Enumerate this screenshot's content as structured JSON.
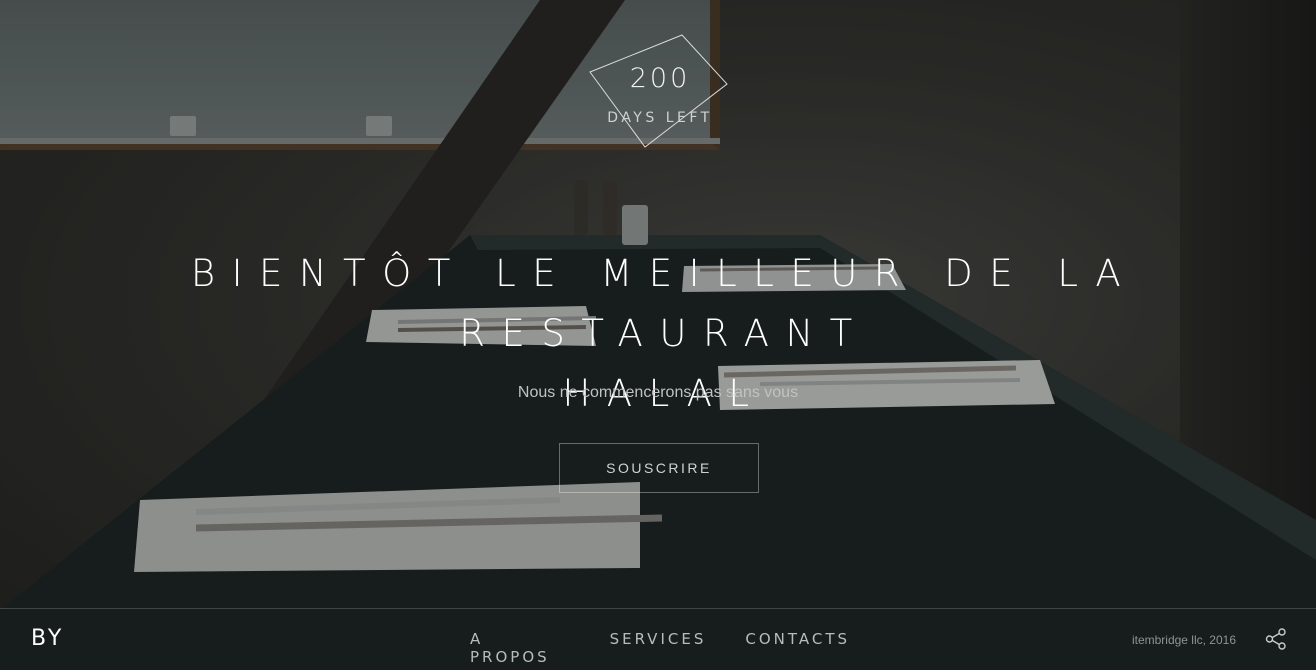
{
  "countdown": {
    "number": "200",
    "label": "DAYS LEFT"
  },
  "hero": {
    "title_line1": "BIENTÔT LE MEILLEUR DE LA RESTAURANT",
    "title_line2": "HALAL",
    "subtitle": "Nous ne commencerons pas sans vous",
    "subscribe_label": "SOUSCRIRE"
  },
  "footer": {
    "logo": "BY",
    "nav": [
      "A PROPOS",
      "SERVICES",
      "CONTACTS"
    ],
    "copyright": "itembridge llc, 2016",
    "share_icon": "share-icon"
  }
}
